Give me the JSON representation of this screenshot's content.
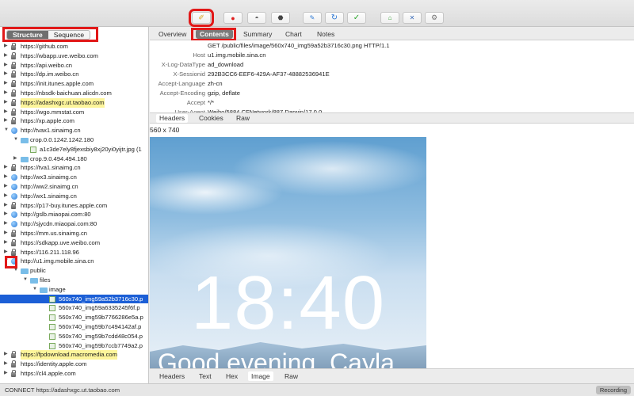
{
  "toolbar": {
    "buttons": [
      {
        "icon": "broom-icon",
        "glyph": "🧹"
      },
      {
        "icon": "record-icon",
        "glyph": "●"
      },
      {
        "icon": "turtle-icon",
        "glyph": "◓"
      },
      {
        "icon": "hexagon-icon",
        "glyph": "⬣"
      },
      {
        "icon": "pen-icon",
        "glyph": "✎"
      },
      {
        "icon": "refresh-icon",
        "glyph": "↻"
      },
      {
        "icon": "check-icon",
        "glyph": "✓"
      },
      {
        "icon": "basket-icon",
        "glyph": "⌂"
      },
      {
        "icon": "tools-icon",
        "glyph": "✕"
      },
      {
        "icon": "settings-icon",
        "glyph": "⚙"
      }
    ]
  },
  "left": {
    "seg_structure": "Structure",
    "seg_sequence": "Sequence"
  },
  "tree": [
    {
      "label": "https://github.com",
      "icon": "lock",
      "level": 0,
      "arrow": "▶"
    },
    {
      "label": "https://wbapp.uve.weibo.com",
      "icon": "lock",
      "level": 0,
      "arrow": "▶"
    },
    {
      "label": "https://api.weibo.cn",
      "icon": "lock",
      "level": 0,
      "arrow": "▶"
    },
    {
      "label": "https://dp.im.weibo.cn",
      "icon": "lock",
      "level": 0,
      "arrow": "▶"
    },
    {
      "label": "https://init.itunes.apple.com",
      "icon": "lock",
      "level": 0,
      "arrow": "▶"
    },
    {
      "label": "https://nbsdk-baichuan.alicdn.com",
      "icon": "lock",
      "level": 0,
      "arrow": "▶"
    },
    {
      "label": "https://adashxgc.ut.taobao.com",
      "icon": "lock",
      "level": 0,
      "arrow": "▶",
      "highlight": true
    },
    {
      "label": "https://wgo.mmstat.com",
      "icon": "lock",
      "level": 0,
      "arrow": "▶"
    },
    {
      "label": "https://xp.apple.com",
      "icon": "lock",
      "level": 0,
      "arrow": "▶"
    },
    {
      "label": "http://tvax1.sinaimg.cn",
      "icon": "globe",
      "level": 0,
      "arrow": "▼"
    },
    {
      "label": "crop.0.0.1242.1242.180",
      "icon": "folder",
      "level": 1,
      "arrow": "▼"
    },
    {
      "label": "a1c3de7ely8fjexsbiy8xj20yi0yijtr.jpg (1",
      "icon": "file",
      "level": 2,
      "arrow": ""
    },
    {
      "label": "crop.9.0.494.494.180",
      "icon": "folder",
      "level": 1,
      "arrow": "▶"
    },
    {
      "label": "https://tva1.sinaimg.cn",
      "icon": "lock",
      "level": 0,
      "arrow": "▶"
    },
    {
      "label": "http://wx3.sinaimg.cn",
      "icon": "globe",
      "level": 0,
      "arrow": "▶"
    },
    {
      "label": "http://ww2.sinaimg.cn",
      "icon": "globe",
      "level": 0,
      "arrow": "▶"
    },
    {
      "label": "http://wx1.sinaimg.cn",
      "icon": "globe",
      "level": 0,
      "arrow": "▶"
    },
    {
      "label": "https://p17-buy.itunes.apple.com",
      "icon": "lock",
      "level": 0,
      "arrow": "▶"
    },
    {
      "label": "http://gslb.miaopai.com:80",
      "icon": "globe",
      "level": 0,
      "arrow": "▶"
    },
    {
      "label": "http://sjycdn.miaopai.com:80",
      "icon": "globe",
      "level": 0,
      "arrow": "▶"
    },
    {
      "label": "https://mm.us.sinaimg.cn",
      "icon": "lock",
      "level": 0,
      "arrow": "▶"
    },
    {
      "label": "https://sdkapp.uve.weibo.com",
      "icon": "lock",
      "level": 0,
      "arrow": "▶"
    },
    {
      "label": "https://116.211.118.96",
      "icon": "lock",
      "level": 0,
      "arrow": "▶"
    },
    {
      "label": "http://u1.img.mobile.sina.cn",
      "icon": "globe",
      "level": 0,
      "arrow": "▼"
    },
    {
      "label": "public",
      "icon": "folder",
      "level": 1,
      "arrow": "▼"
    },
    {
      "label": "files",
      "icon": "folder",
      "level": 2,
      "arrow": "▼"
    },
    {
      "label": "image",
      "icon": "folder",
      "level": 3,
      "arrow": "▼"
    },
    {
      "label": "560x740_img59a52b3716c30.p",
      "icon": "file",
      "level": 4,
      "arrow": "",
      "selected": true
    },
    {
      "label": "560x740_img59a6335245f6f.p",
      "icon": "file",
      "level": 4,
      "arrow": ""
    },
    {
      "label": "560x740_img59b7766286e5a.p",
      "icon": "file",
      "level": 4,
      "arrow": ""
    },
    {
      "label": "560x740_img59b7c494142af.p",
      "icon": "file",
      "level": 4,
      "arrow": ""
    },
    {
      "label": "560x740_img59b7cdd48c054.p",
      "icon": "file",
      "level": 4,
      "arrow": ""
    },
    {
      "label": "560x740_img59b7ccb7749a2.p",
      "icon": "file",
      "level": 4,
      "arrow": ""
    },
    {
      "label": "https://fpdownload.macromedia.com",
      "icon": "lock",
      "level": 0,
      "arrow": "▶",
      "highlight": true
    },
    {
      "label": "https://identity.apple.com",
      "icon": "lock",
      "level": 0,
      "arrow": "▶"
    },
    {
      "label": "https://cl4.apple.com",
      "icon": "lock",
      "level": 0,
      "arrow": "▶"
    }
  ],
  "tabs": {
    "overview": "Overview",
    "contents": "Contents",
    "summary": "Summary",
    "chart": "Chart",
    "notes": "Notes"
  },
  "request_headers": [
    {
      "key": "",
      "value": "GET /public/files/image/560x740_img59a52b3716c30.png HTTP/1.1"
    },
    {
      "key": "Host",
      "value": "u1.img.mobile.sina.cn"
    },
    {
      "key": "X-Log-DataType",
      "value": "ad_download"
    },
    {
      "key": "X-Sessionid",
      "value": "292B3CC6-EEF6-429A-AF37-48882536941E"
    },
    {
      "key": "Accept-Language",
      "value": "zh-cn"
    },
    {
      "key": "Accept-Encoding",
      "value": "gzip, deflate"
    },
    {
      "key": "Accept",
      "value": "*/*"
    },
    {
      "key": "User-Agent",
      "value": "Weibo/5884 CFNetwork/887 Darwin/17.0.0"
    }
  ],
  "subtabs": {
    "headers": "Headers",
    "cookies": "Cookies",
    "raw": "Raw"
  },
  "image": {
    "dimensions": "560 x 740",
    "clock": "18:40",
    "greeting": "Good evening, Cayla"
  },
  "bottom_tabs": {
    "headers": "Headers",
    "text": "Text",
    "hex": "Hex",
    "image": "Image",
    "raw": "Raw"
  },
  "status": {
    "text": "CONNECT https://adashxgc.ut.taobao.com",
    "recording": "Recording"
  }
}
